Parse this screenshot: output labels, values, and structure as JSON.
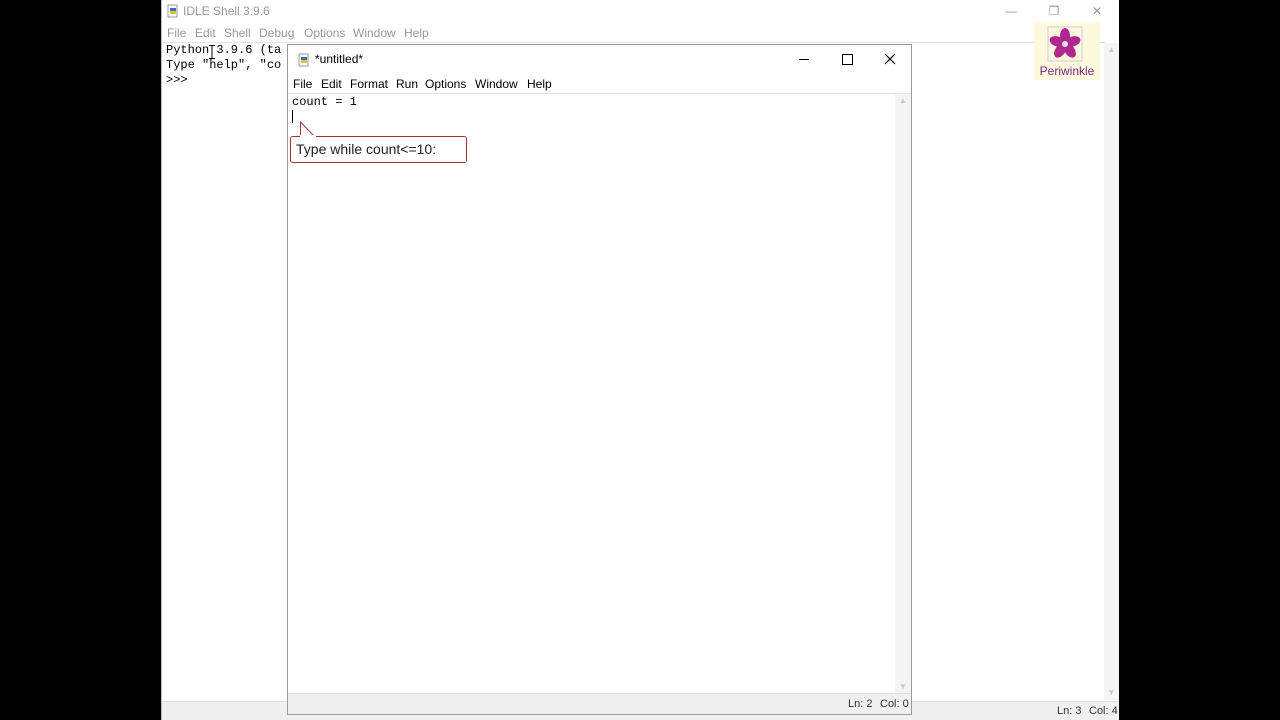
{
  "shell": {
    "title": "IDLE Shell 3.9.6",
    "menu": [
      "File",
      "Edit",
      "Shell",
      "Debug",
      "Options",
      "Window",
      "Help"
    ],
    "lines": [
      "Python 3.9.6 (ta",
      "Type \"help\", \"co",
      ">>>"
    ],
    "status": {
      "line": "Ln: 3",
      "col": "Col: 4"
    }
  },
  "logo": {
    "text": "Periwinkle"
  },
  "editor": {
    "title": "*untitled*",
    "menu": [
      "File",
      "Edit",
      "Format",
      "Run",
      "Options",
      "Window",
      "Help"
    ],
    "code_lines": [
      "count = 1",
      ""
    ],
    "status": {
      "line": "Ln: 2",
      "col": "Col: 0"
    }
  },
  "callout": {
    "text": "Type while count<=10:"
  },
  "colors": {
    "callout_border": "#b03030",
    "logo_text": "#7b2a86",
    "logo_bg": "#fdf9dd"
  }
}
